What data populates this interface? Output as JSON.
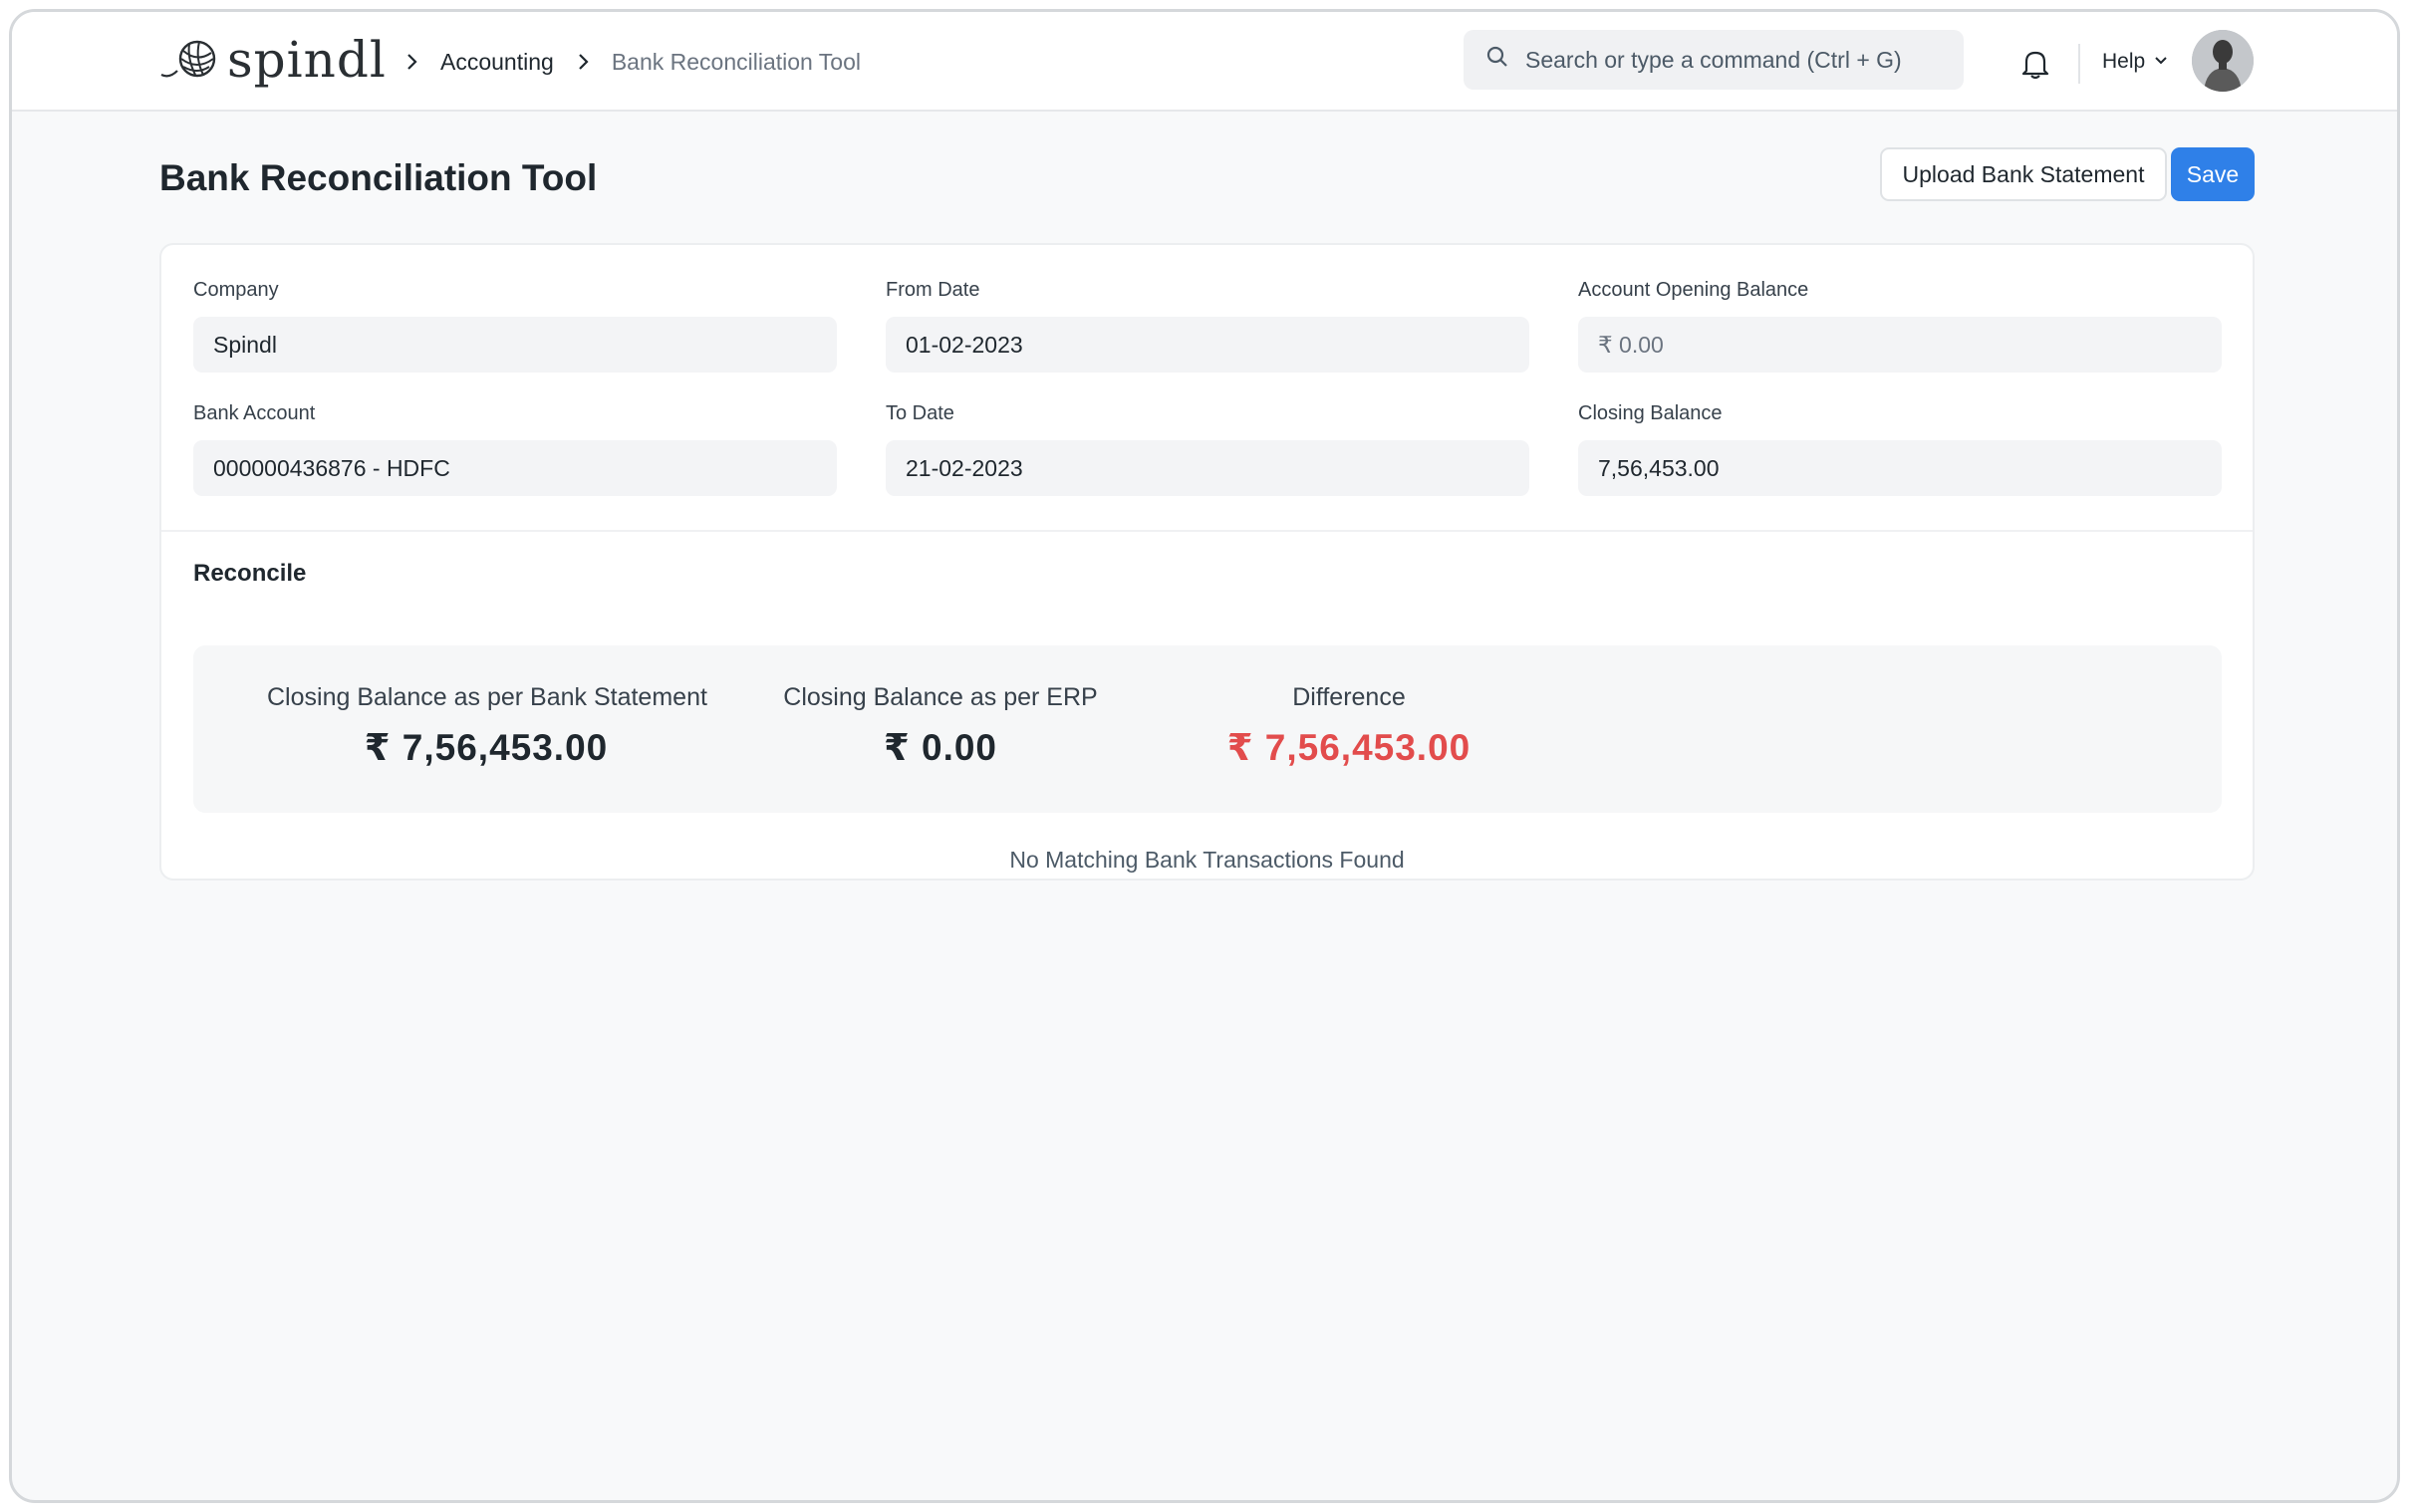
{
  "navbar": {
    "logo_text": "spindl",
    "breadcrumbs": [
      "Accounting",
      "Bank Reconciliation Tool"
    ],
    "search_placeholder": "Search or type a command (Ctrl + G)",
    "help_label": "Help",
    "icons": [
      "yarn-logo-icon",
      "chevron-right-icon",
      "search-icon",
      "bell-icon",
      "chevron-down-icon",
      "avatar"
    ]
  },
  "page": {
    "title": "Bank Reconciliation Tool",
    "upload_label": "Upload Bank Statement",
    "save_label": "Save"
  },
  "form": {
    "company": {
      "label": "Company",
      "value": "Spindl"
    },
    "bank_account": {
      "label": "Bank Account",
      "value": "000000436876 - HDFC"
    },
    "from_date": {
      "label": "From Date",
      "value": "01-02-2023"
    },
    "to_date": {
      "label": "To Date",
      "value": "21-02-2023"
    },
    "opening_balance": {
      "label": "Account Opening Balance",
      "value": "₹ 0.00"
    },
    "closing_balance": {
      "label": "Closing Balance",
      "value": "7,56,453.00"
    }
  },
  "reconcile": {
    "title": "Reconcile",
    "bank_statement": {
      "label": "Closing Balance as per Bank Statement",
      "value": "₹ 7,56,453.00"
    },
    "erp": {
      "label": "Closing Balance as per ERP",
      "value": "₹ 0.00"
    },
    "difference": {
      "label": "Difference",
      "value": "₹ 7,56,453.00"
    },
    "empty_message": "No Matching Bank Transactions Found"
  },
  "colors": {
    "primary": "#2f80e8",
    "negative": "#e24c4c",
    "background": "#f8f9fa"
  }
}
